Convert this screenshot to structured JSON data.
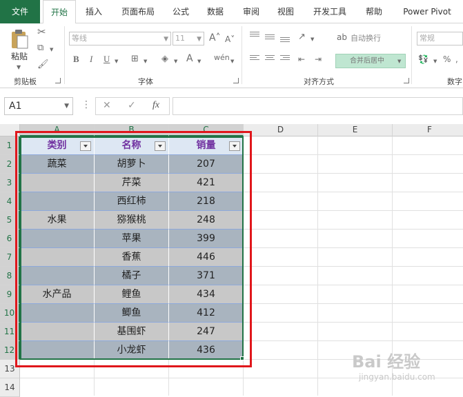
{
  "tabs": [
    "文件",
    "开始",
    "插入",
    "页面布局",
    "公式",
    "数据",
    "审阅",
    "视图",
    "开发工具",
    "帮助",
    "Power Pivot"
  ],
  "ribbon": {
    "paste_label": "粘贴",
    "clipboard_label": "剪贴板",
    "font_label": "字体",
    "alignment_label": "对齐方式",
    "number_label": "数字",
    "font_name": "等线",
    "font_size": "11",
    "wrap_text": "自动换行",
    "merge_center": "合并后居中",
    "number_format": "常规"
  },
  "formula_bar": {
    "name_box": "A1",
    "fx": "fx",
    "cancel": "✕",
    "enter": "✓",
    "more": "⋮"
  },
  "columns": [
    "A",
    "B",
    "C",
    "D",
    "E",
    "F"
  ],
  "rows": [
    "1",
    "2",
    "3",
    "4",
    "5",
    "6",
    "7",
    "8",
    "9",
    "10",
    "11",
    "12",
    "13",
    "14"
  ],
  "table": {
    "headers": [
      "类别",
      "名称",
      "销量"
    ],
    "rows": [
      [
        "蔬菜",
        "胡萝卜",
        "207"
      ],
      [
        "",
        "芹菜",
        "421"
      ],
      [
        "",
        "西红柿",
        "218"
      ],
      [
        "水果",
        "猕猴桃",
        "248"
      ],
      [
        "",
        "苹果",
        "399"
      ],
      [
        "",
        "香蕉",
        "446"
      ],
      [
        "",
        "橘子",
        "371"
      ],
      [
        "水产品",
        "鲤鱼",
        "434"
      ],
      [
        "",
        "鲫鱼",
        "412"
      ],
      [
        "",
        "基围虾",
        "247"
      ],
      [
        "",
        "小龙虾",
        "436"
      ]
    ]
  },
  "watermark": {
    "title": "Bai 经验",
    "sub": "jingyan.baidu.com"
  }
}
